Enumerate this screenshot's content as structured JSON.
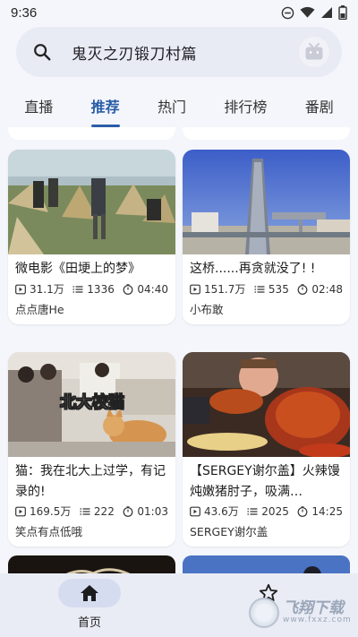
{
  "status_bar": {
    "time": "9:36"
  },
  "search": {
    "query": "鬼灭之刃锻刀村篇"
  },
  "tabs": [
    "直播",
    "推荐",
    "热门",
    "排行榜",
    "番剧"
  ],
  "active_tab": "推荐",
  "cards": [
    {
      "title": "微电影《田埂上的梦》",
      "views": "31.1万",
      "danmaku": "1336",
      "duration": "04:40",
      "author": "点点唐He"
    },
    {
      "title": "这桥......再贪就没了! !",
      "views": "151.7万",
      "danmaku": "535",
      "duration": "02:48",
      "author": "小布敢"
    },
    {
      "title": "猫：我在北大上过学，有记录的!",
      "views": "169.5万",
      "danmaku": "222",
      "duration": "01:03",
      "author": "笑点有点低哦"
    },
    {
      "title": "【SERGEY谢尔盖】火辣馒炖嫩猪肘子，吸满…",
      "views": "43.6万",
      "danmaku": "2025",
      "duration": "14:25",
      "author": "SERGEY谢尔盖"
    }
  ],
  "thumb_caption_3": "北大校猫",
  "bottom_nav": {
    "home_label": "首页"
  },
  "watermark": {
    "main": "飞翔下载",
    "sub": "www.fxxz.com"
  },
  "colors": {
    "accent": "#2a5da8",
    "background": "#f4f6fb",
    "nav": "#e9ecf5"
  }
}
